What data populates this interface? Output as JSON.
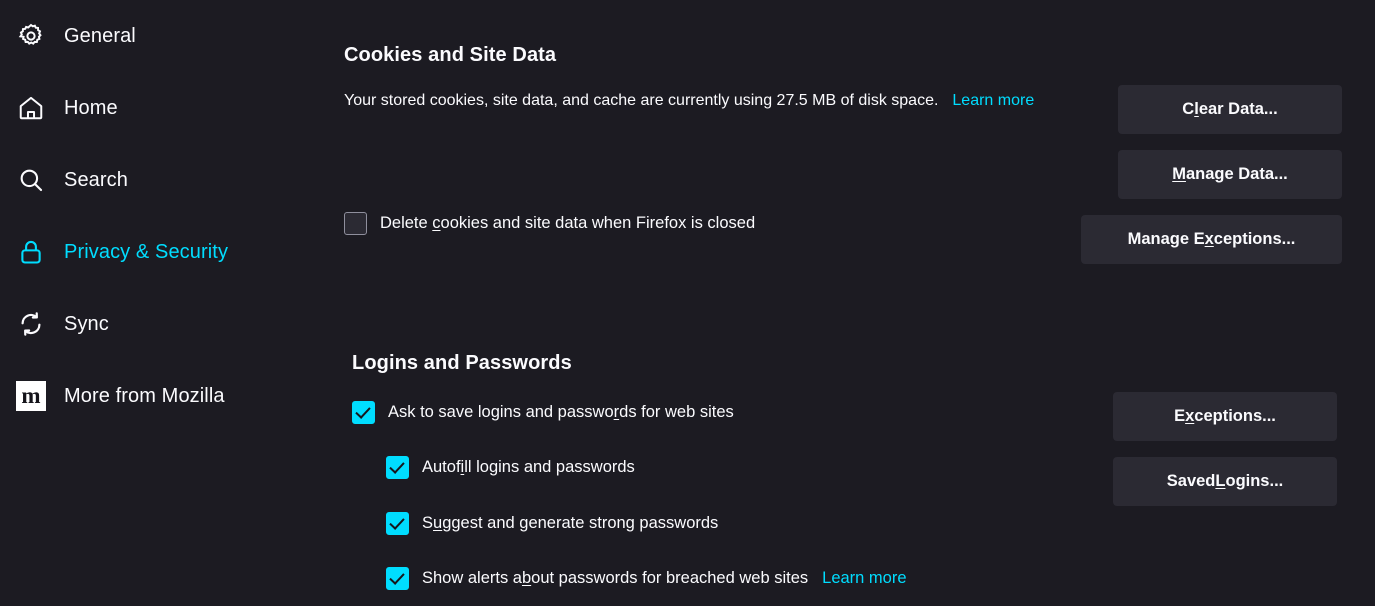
{
  "theme": {
    "background": "#1c1b22",
    "text": "#fbfbfe",
    "accent": "#00ddff",
    "button_bg": "#2b2a33",
    "checkbox_off_border": "#8f8f9d"
  },
  "sidebar": {
    "items": [
      {
        "id": "general",
        "label": "General",
        "icon": "gear-icon",
        "selected": false
      },
      {
        "id": "home",
        "label": "Home",
        "icon": "home-icon",
        "selected": false
      },
      {
        "id": "search",
        "label": "Search",
        "icon": "search-icon",
        "selected": false
      },
      {
        "id": "privacy",
        "label": "Privacy & Security",
        "icon": "lock-icon",
        "selected": true
      },
      {
        "id": "sync",
        "label": "Sync",
        "icon": "sync-icon",
        "selected": false
      },
      {
        "id": "mozilla",
        "label": "More from Mozilla",
        "icon": "mozilla-icon",
        "selected": false,
        "tile_glyph": "m"
      }
    ]
  },
  "cookies_section": {
    "title": "Cookies and Site Data",
    "description_before": "Your stored cookies, site data, and cache are currently using 27.5 MB of disk space.",
    "description_usage": "27.5 MB",
    "learn_more": "Learn more",
    "delete_on_close": {
      "label_pre": "Delete ",
      "accesskey": "c",
      "label_post": "ookies and site data when Firefox is closed",
      "checked": false
    },
    "buttons": [
      {
        "id": "clear-data",
        "pre": "C",
        "accesskey": "l",
        "post": "ear Data..."
      },
      {
        "id": "manage-data",
        "pre": "",
        "accesskey": "M",
        "post": "anage Data..."
      },
      {
        "id": "manage-exceptions",
        "pre": "Manage E",
        "accesskey": "x",
        "post": "ceptions..."
      }
    ]
  },
  "logins_section": {
    "title": "Logins and Passwords",
    "ask_to_save": {
      "label_pre": "Ask to save logins and passwo",
      "accesskey": "r",
      "label_post": "ds for web sites",
      "checked": true
    },
    "sub_options": [
      {
        "id": "autofill",
        "label_pre": "Autof",
        "accesskey": "i",
        "label_post": "ll logins and passwords",
        "checked": true,
        "learn_more": ""
      },
      {
        "id": "suggest",
        "label_pre": "S",
        "accesskey": "u",
        "label_post": "ggest and generate strong passwords",
        "checked": true,
        "learn_more": ""
      },
      {
        "id": "breach",
        "label_pre": "Show alerts a",
        "accesskey": "b",
        "label_post": "out passwords for breached web sites",
        "checked": true,
        "learn_more": "Learn more"
      }
    ],
    "buttons": [
      {
        "id": "exceptions",
        "pre": "E",
        "accesskey": "x",
        "post": "ceptions..."
      },
      {
        "id": "saved-logins",
        "pre": "Saved ",
        "accesskey": "L",
        "post": "ogins..."
      }
    ]
  }
}
